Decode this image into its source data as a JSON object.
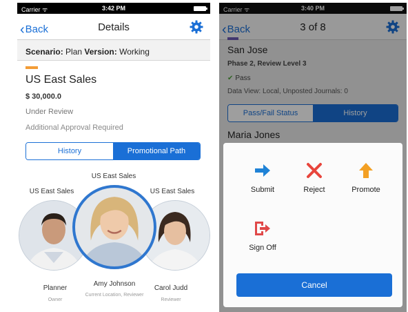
{
  "left": {
    "status": {
      "carrier": "Carrier ᯤ",
      "time": "3:42 PM"
    },
    "nav": {
      "back": "Back",
      "title": "Details"
    },
    "scenario": {
      "label1": "Scenario:",
      "value1": "Plan",
      "label2": "Version:",
      "value2": "Working"
    },
    "title": "US East Sales",
    "amount": "$ 30,000.0",
    "status_text": "Under Review",
    "approval_text": "Additional Approval Required",
    "tabs": [
      {
        "label": "History",
        "active": false
      },
      {
        "label": "Promotional Path",
        "active": true
      }
    ],
    "path": {
      "top_label": "US East Sales",
      "left_label": "US East Sales",
      "right_label": "US East Sales",
      "left_name": "Planner",
      "left_role": "Owner",
      "center_name": "Amy Johnson",
      "center_role": "Current Location, Reviewer",
      "right_name": "Carol Judd",
      "right_role": "Reviewer"
    }
  },
  "right": {
    "status": {
      "carrier": "Carrier ᯤ",
      "time": "3:40 PM"
    },
    "nav": {
      "back": "Back",
      "title": "3 of 8"
    },
    "city": "San Jose",
    "phase": "Phase 2, Review Level 3",
    "pass": "Pass",
    "data_view": "Data View: Local, Unposted Journals: 0",
    "tabs": [
      {
        "label": "Pass/Fail Status",
        "active": false
      },
      {
        "label": "History",
        "active": true
      }
    ],
    "person": "Maria Jones",
    "actions": {
      "submit": "Submit",
      "reject": "Reject",
      "promote": "Promote",
      "signoff": "Sign Off"
    },
    "cancel": "Cancel"
  },
  "colors": {
    "accent": "#1a6fd6",
    "orange": "#f39c36",
    "reject": "#e8453c",
    "promote": "#f3a024",
    "signoff": "#e04848",
    "purple": "#6b5ab2"
  }
}
